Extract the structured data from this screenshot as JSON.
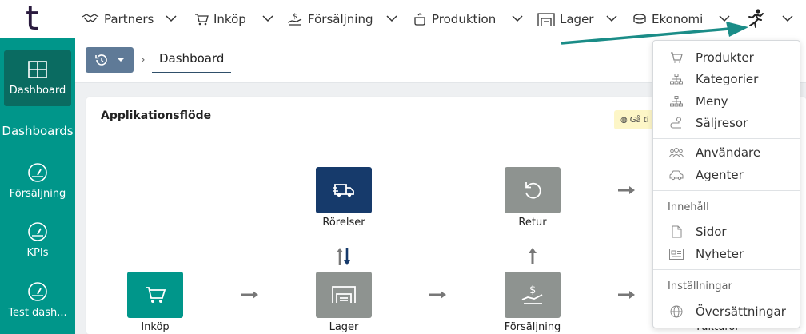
{
  "logo": "t",
  "nav": {
    "items": [
      {
        "label": "Partners",
        "icon": "handshake-icon"
      },
      {
        "label": "Inköp",
        "icon": "cart-icon"
      },
      {
        "label": "Försäljning",
        "icon": "hand-dollar-icon"
      },
      {
        "label": "Produktion",
        "icon": "pot-icon"
      },
      {
        "label": "Lager",
        "icon": "warehouse-icon"
      },
      {
        "label": "Ekonomi",
        "icon": "coins-icon"
      }
    ],
    "user_icon": "running-person-icon"
  },
  "sidebar": {
    "active": {
      "label": "Dashboard",
      "icon": "grid-icon"
    },
    "heading": "Dashboards",
    "items": [
      {
        "label": "Försäljning",
        "icon": "gauge-icon"
      },
      {
        "label": "KPIs",
        "icon": "gauge-icon"
      },
      {
        "label": "Test dash..."
      }
    ]
  },
  "breadcrumb": {
    "history_icon": "history-icon",
    "current": "Dashboard"
  },
  "card": {
    "title": "Applikationsflöde",
    "goto_label": "Gå ti",
    "nodes": {
      "rorelser": "Rörelser",
      "retur": "Retur",
      "inkop": "Inköp",
      "lager": "Lager",
      "forsaljning": "Försäljning",
      "fakturor": "Fakturor"
    }
  },
  "dropdown": {
    "group1": [
      {
        "label": "Produkter",
        "icon": "cart-icon"
      },
      {
        "label": "Kategorier",
        "icon": "sitemap-icon"
      },
      {
        "label": "Meny",
        "icon": "sitemap-icon"
      },
      {
        "label": "Säljresor",
        "icon": "route-icon"
      }
    ],
    "group2": [
      {
        "label": "Användare",
        "icon": "users-icon"
      },
      {
        "label": "Agenter",
        "icon": "car-icon"
      }
    ],
    "heading_content": "Innehåll",
    "group3": [
      {
        "label": "Sidor",
        "icon": "page-icon"
      },
      {
        "label": "Nyheter",
        "icon": "newspaper-icon"
      }
    ],
    "heading_settings": "Inställningar",
    "group4": [
      {
        "label": "Översättningar",
        "icon": "globe-icon"
      }
    ]
  },
  "colors": {
    "teal": "#00968a",
    "teal_dark": "#0a6b61",
    "navy": "#163a6b",
    "gray_node": "#8e9390",
    "history_btn": "#5f7a97",
    "pointer_arrow": "#1a8c87"
  }
}
